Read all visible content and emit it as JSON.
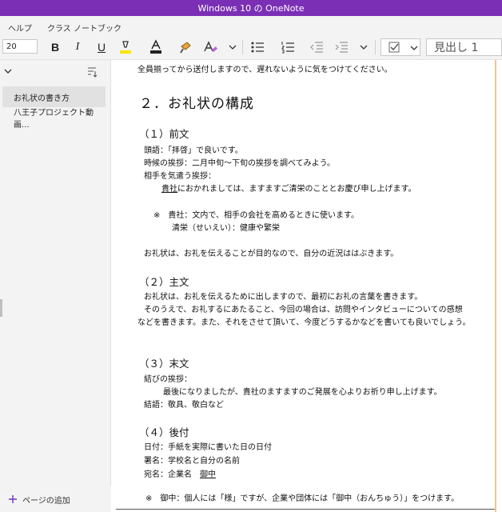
{
  "window": {
    "title": "Windows 10 の OneNote"
  },
  "menu": {
    "items": [
      "ヘルプ",
      "クラス ノートブック"
    ]
  },
  "toolbar": {
    "font_size": "20",
    "bold": "B",
    "italic": "I",
    "underline": "U",
    "style_value": "見出し 1",
    "icons": [
      "highlight-icon",
      "font-color-icon",
      "format-painter-icon",
      "clear-format-icon",
      "chevron-down-icon",
      "bullet-list-icon",
      "numbered-list-icon",
      "outdent-icon",
      "indent-icon",
      "checkbox-icon"
    ]
  },
  "sidebar": {
    "pages": [
      {
        "title": "お礼状の書き方",
        "selected": true
      },
      {
        "title": "八王子プロジェクト動画..."
      }
    ],
    "add_page": "ページの追加"
  },
  "note": {
    "intro": "全員揃ってから送付しますので、遅れないように気をつけてください。",
    "heading": "２．お礼状の構成",
    "sec1_title": "（１）前文",
    "sec1_l1": "頭語：「拝啓」で良いです。",
    "sec1_l2": "時候の挨拶：二月中旬〜下旬の挨拶を調べてみよう。",
    "sec1_l3": "相手を気遣う挨拶：",
    "sec1_l4_u": "貴社",
    "sec1_l4_rest": "におかれましては、ますますご清栄のこととお慶び申し上げます。",
    "sec1_note1": "※　貴社：文内で、相手の会社を高めるときに使います。",
    "sec1_note2": "清栄（せいえい）：健康や繁栄",
    "sec1_l5": "お礼状は、お礼を伝えることが目的なので、自分の近況ははぶきます。",
    "sec2_title": "（２）主文",
    "sec2_l1": "お礼状は、お礼を伝えるために出しますので、最初にお礼の言葉を書きます。",
    "sec2_l2": "そのうえで、お礼するにあたること、今回の場合は、訪問やインタビューについての感想",
    "sec2_l3": "などを書きます。また、それをさせて頂いて、今度どうするかなどを書いても良いでしょう。",
    "sec3_title": "（３）末文",
    "sec3_l1": "結びの挨拶：",
    "sec3_l2": "最後になりましたが、貴社のますますのご発展を心よりお祈り申し上げます。",
    "sec3_l3": "結語：敬具、敬白など",
    "sec4_title": "（４）後付",
    "sec4_l1": "日付：手紙を実際に書いた日の日付",
    "sec4_l2": "署名：学校名と自分の名前",
    "sec4_l3_a": "宛名：企業名　",
    "sec4_l3_u": "御中",
    "sec4_note": "※　御中：個人には「様」ですが、企業や団体には「御中（おんちゅう）」をつけます。"
  },
  "colors": {
    "accent": "#7b2fb5",
    "highlight": "#f5e800",
    "page_rule": "#f4c18f"
  }
}
